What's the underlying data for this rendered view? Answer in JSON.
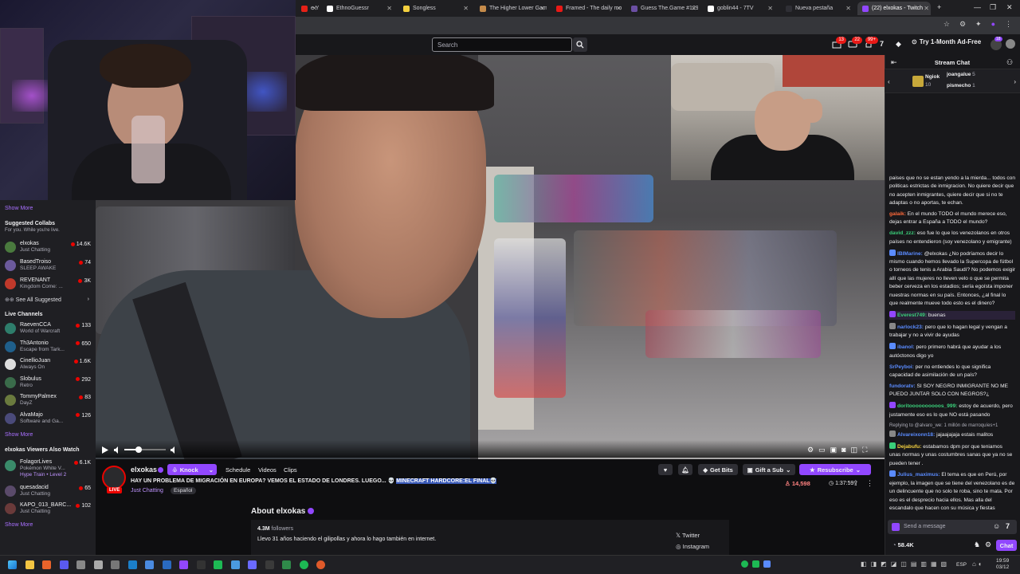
{
  "browser": {
    "tabs": [
      {
        "label": "e Yo",
        "color": "#e62117"
      },
      {
        "label": "EthnoGuessr",
        "color": "#ffffff"
      },
      {
        "label": "Songless",
        "color": "#f4d03f"
      },
      {
        "label": "The Higher Lower Gam",
        "color": "#c58b4a"
      },
      {
        "label": "Framed - The daily mo",
        "color": "#e91916"
      },
      {
        "label": "Guess The.Game #129",
        "color": "#6b4fa3"
      },
      {
        "label": "goblin44 - 7TV",
        "color": "#ffffff"
      },
      {
        "label": "Nueva pestaña",
        "color": "#2f2f35"
      },
      {
        "label": "(22) elxokas - Twitch",
        "color": "#9147ff"
      }
    ]
  },
  "nav": {
    "search_placeholder": "Search",
    "badges": [
      "13",
      "22",
      "99+"
    ],
    "try_label": "Try 1-Month Ad-Free",
    "avatar_badge": "18"
  },
  "sidebar": {
    "show_more": "Show More",
    "suggested_title": "Suggested Collabs",
    "suggested_sub": "For you. While you're live.",
    "suggested": [
      {
        "name": "elxokas",
        "game": "Just Chatting",
        "viewers": "14.6K",
        "color": "#4a7a3e"
      },
      {
        "name": "BasedTroiso",
        "game": "SLEEP AWAKE",
        "viewers": "74",
        "color": "#6b5a9c"
      },
      {
        "name": "REVENANT",
        "game": "Kingdom Come: ...",
        "viewers": "3K",
        "color": "#c0392b"
      }
    ],
    "see_all": "See All Suggested",
    "live_title": "Live Channels",
    "live": [
      {
        "name": "RaevenCCA",
        "game": "World of Warcraft",
        "viewers": "133",
        "color": "#2e7d6b"
      },
      {
        "name": "Th3Antonio",
        "game": "Escape from Tark...",
        "viewers": "650",
        "color": "#1f5f8b"
      },
      {
        "name": "CinellioJuan",
        "game": "Always On",
        "viewers": "1.6K",
        "color": "#dddddd"
      },
      {
        "name": "Slobulus",
        "game": "Retro",
        "viewers": "292",
        "color": "#3a6b4a"
      },
      {
        "name": "TommyPalmex",
        "game": "DayZ",
        "viewers": "83",
        "color": "#6a7a3e"
      },
      {
        "name": "AlvaMajo",
        "game": "Software and Ga...",
        "viewers": "126",
        "color": "#4a4a7a"
      }
    ],
    "watch_title": "elxokas Viewers Also Watch",
    "watch": [
      {
        "name": "FolagorLives",
        "game": "Pokémon White V...",
        "viewers": "6.1K",
        "color": "#3a8b6a",
        "extra": "Hype Train • Level 2"
      },
      {
        "name": "quesadacid",
        "game": "Just Chatting",
        "viewers": "65",
        "color": "#5a4a6a"
      },
      {
        "name": "KAPO_013_BARC...",
        "game": "Just Chatting",
        "viewers": "102",
        "color": "#6a3a3a"
      }
    ]
  },
  "channel": {
    "name": "elxokas",
    "live_badge": "LIVE",
    "knock": "Knock",
    "links": [
      "Schedule",
      "Videos",
      "Clips"
    ],
    "title": "HAY UN PROBLEMA DE MIGRACIÓN EN EUROPA? VEMOS EL ESTADO DE LONDRES. LUEGO... 💀",
    "title_highlight": "MINECRAFT HARDCORE:EL FINAL💀",
    "game": "Just Chatting",
    "tag": "Español",
    "get_bits": "Get Bits",
    "gift_sub": "Gift a Sub",
    "resubscribe": "Resubscribe",
    "viewers": "14,598",
    "uptime": "1:37:59",
    "about_title": "About elxokas",
    "followers_count": "4.3M",
    "followers_label": "followers",
    "bio": "Llevo 31 años haciendo el gilipollas y ahora lo hago también en internet.",
    "twitter": "Twitter",
    "instagram": "Instagram"
  },
  "chat": {
    "header": "Stream Chat",
    "gifters": [
      {
        "name": "Ngiok",
        "count": "10"
      },
      {
        "name": "joangalue",
        "count": "5"
      },
      {
        "name": "pismecho",
        "count": "1"
      }
    ],
    "messages": [
      {
        "user": "",
        "color": "#efeff1",
        "text": "paises que no se estan yendo a la mierda... todos con politicas estrictas de inmigracion. No quiere decir que no acepten inmigrantes, quiere decir que si no te adaptas o no aportas, te echan.",
        "badge": ""
      },
      {
        "user": "galaik:",
        "color": "#ff6a3a",
        "text": "En el mundo TODO el mundo merece eso, dejas entrar a España a TODO el mundo?",
        "badge": ""
      },
      {
        "user": "david_zzz:",
        "color": "#3acf7a",
        "text": "eso fue lo que los venezolanos en otros países no entendieron (soy venezolano y emigrante)",
        "badge": ""
      },
      {
        "user": "IBIMarine:",
        "color": "#5a8bff",
        "text": "@elxokas ¿No podríamos decir lo mismo cuando hemos llevado la Supercopa de fútbol o torneos de tenis a Arabia Saudí? No podemos exigir allí que las mujeres no lleven velo o que se permita beber cerveza en los estadios; sería egoísta imponer nuestras normas en su país. Entonces, ¿al final lo que realmente mueve todo esto es el dinero?",
        "badge": "#5a8bff"
      },
      {
        "user": "Everest749:",
        "color": "#3acf7a",
        "text": "buenas",
        "badge": "#9147ff",
        "highlight": true
      },
      {
        "user": "narlock23:",
        "color": "#5a8bff",
        "text": "pero que lo hagan legal y vengan a trabajar y no a vivir de ayudas",
        "badge": "#888"
      },
      {
        "user": "ibanol:",
        "color": "#5a8bff",
        "text": "pero primero habrá que ayudar a los autóctonos digo yo",
        "badge": "#5a8bff"
      },
      {
        "user": "SrPeyboi:",
        "color": "#5a8bff",
        "text": "per no entiendes lo que significa capacidad de asimilación de un país?",
        "badge": ""
      },
      {
        "user": "fundoratv:",
        "color": "#5a8bff",
        "text": "SI SOY NEGRO INMIGRANTE NO ME PUEDO JUNTAR SOLO CON NEGROS?¿",
        "badge": ""
      },
      {
        "user": "doritoooooooooos_999:",
        "color": "#3acf7a",
        "text": "estoy de acuerdo, pero justamente eso es lo que NO está pasando",
        "badge": "#9147ff"
      },
      {
        "user": "Alvareixonn18:",
        "color": "#5a8bff",
        "text": "jajaajajaja estais malitos",
        "badge": "#888",
        "reply": "Replying to @alvaro_we: 1 millón de marroquíes+1"
      },
      {
        "user": "Dejabufu:",
        "color": "#f4d03f",
        "text": "estabamos dpm por que teniamos unas normas y unas costumbres sanas que ya no se pueden tener .",
        "badge": "#3acf7a"
      },
      {
        "user": "Julius_maximus:",
        "color": "#5a8bff",
        "text": "El tema es que en Perú, por ejemplo, la imagen que se tiene del venezolano es de un delincuente que no solo te roba, sino te mata. Por eso es el desprecio hacia ellos. Mas alla del escandalo que hacen con su música y fiestas",
        "badge": "#5a8bff"
      }
    ],
    "input_placeholder": "Send a message",
    "points": "58.4K",
    "chat_button": "Chat"
  },
  "taskbar": {
    "lang": "ESP",
    "time": "19:59",
    "date": "03/12"
  }
}
